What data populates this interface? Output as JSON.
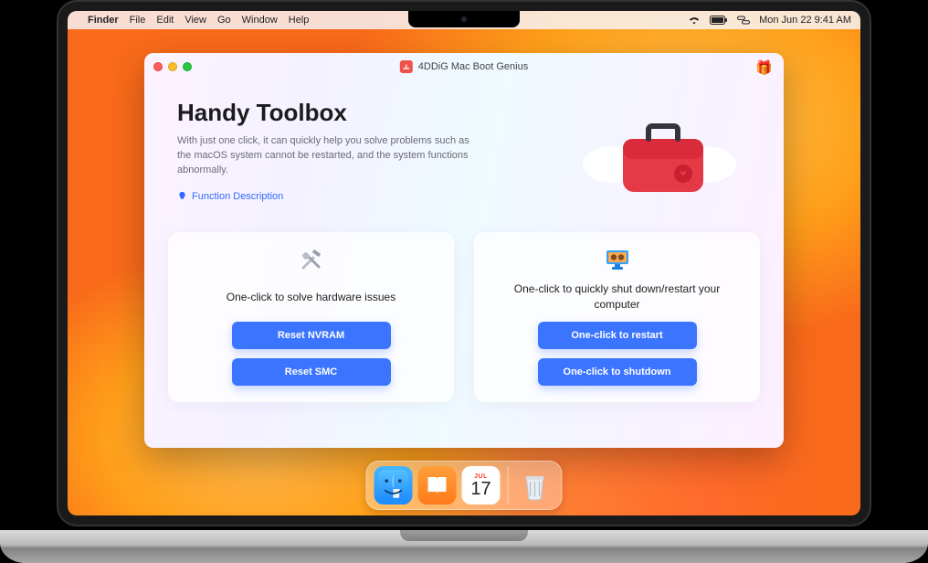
{
  "menubar": {
    "app": "Finder",
    "items": [
      "File",
      "Edit",
      "View",
      "Go",
      "Window",
      "Help"
    ],
    "datetime": "Mon Jun 22  9:41 AM"
  },
  "dock": {
    "calendar_month": "Jul",
    "calendar_day": "17"
  },
  "window": {
    "title": "4DDiG Mac Boot Genius"
  },
  "hero": {
    "heading": "Handy Toolbox",
    "subtitle": "With just one click, it can quickly help you solve problems such as the macOS system cannot be restarted, and the system functions abnormally.",
    "function_link": "Function Description"
  },
  "card_left": {
    "title": "One-click to solve hardware issues",
    "btn1": "Reset NVRAM",
    "btn2": "Reset SMC"
  },
  "card_right": {
    "title": "One-click to quickly shut down/restart your computer",
    "btn1": "One-click to restart",
    "btn2": "One-click to shutdown"
  }
}
